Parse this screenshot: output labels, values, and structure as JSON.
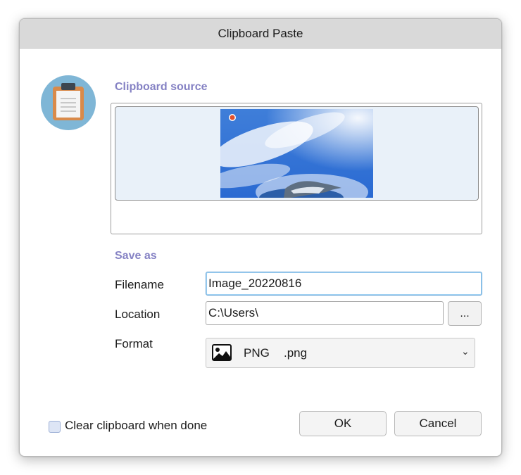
{
  "dialog": {
    "title": "Clipboard Paste"
  },
  "source": {
    "heading": "Clipboard source"
  },
  "save_as": {
    "heading": "Save as",
    "filename_label": "Filename",
    "filename_value": "Image_20220816",
    "location_label": "Location",
    "location_value": "C:\\Users\\",
    "browse_label": "...",
    "format_label": "Format",
    "format_name": "PNG",
    "format_ext": ".png"
  },
  "footer": {
    "clear_label": "Clear clipboard when done",
    "clear_checked": false,
    "ok_label": "OK",
    "cancel_label": "Cancel"
  },
  "icons": {
    "app": "clipboard-icon",
    "format": "image-icon",
    "dropdown": "chevron-down-icon"
  },
  "colors": {
    "accent_heading": "#8582c4",
    "titlebar": "#d9d9d9",
    "focus_border": "#6aa7d8"
  }
}
